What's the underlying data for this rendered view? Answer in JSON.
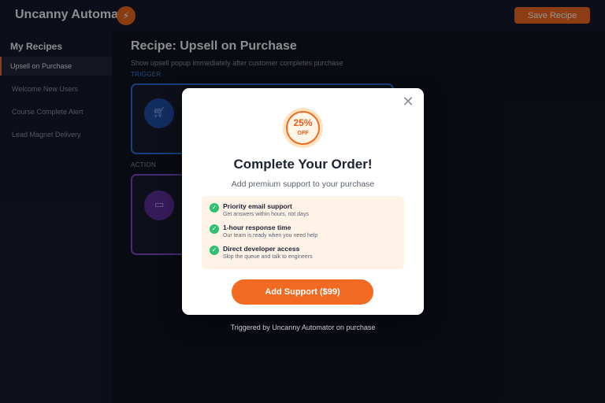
{
  "app": {
    "title": "Uncanny Automator",
    "logo_icon": "lightning-icon",
    "logo_glyph": "⚡",
    "save_label": "Save Recipe"
  },
  "sidebar": {
    "heading": "My Recipes",
    "items": [
      {
        "label": "Upsell on Purchase",
        "active": true
      },
      {
        "label": "Welcome New Users",
        "active": false
      },
      {
        "label": "Course Complete Alert",
        "active": false
      },
      {
        "label": "Lead Magnet Delivery",
        "active": false
      }
    ]
  },
  "recipe": {
    "title": "Recipe: Upsell on Purchase",
    "description": "Show upsell popup immediately after customer completes purchase",
    "trigger_label": "TRIGGER",
    "action_label": "ACTION",
    "trigger_icon": "cart-icon",
    "action_icon": "window-icon"
  },
  "modal": {
    "badge": {
      "percent": "25%",
      "text": "OFF"
    },
    "title": "Complete Your Order!",
    "subtitle": "Add premium support to your purchase",
    "benefits": [
      {
        "title": "Priority email support",
        "desc": "Get answers within hours, not days"
      },
      {
        "title": "1-hour response time",
        "desc": "Our team is ready when you need help"
      },
      {
        "title": "Direct developer access",
        "desc": "Skip the queue and talk to engineers"
      }
    ],
    "cta_label": "Add Support ($99)",
    "close_glyph": "✕"
  },
  "footnote": "Triggered by Uncanny Automator on purchase",
  "colors": {
    "accent": "#f26a21",
    "background": "#10141f",
    "trigger_border": "#2a6fd6",
    "action_border": "#7d4ac9",
    "check": "#2fbf71"
  }
}
